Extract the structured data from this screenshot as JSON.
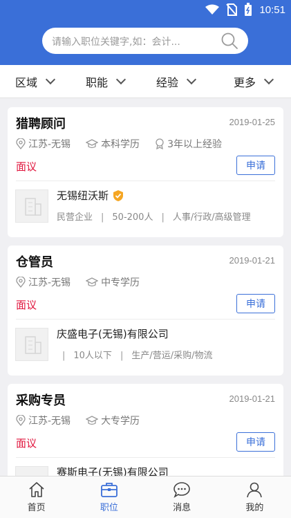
{
  "status": {
    "time": "10:51"
  },
  "search": {
    "placeholder": "请输入职位关键字,如：会计..."
  },
  "filters": [
    {
      "label": "区域"
    },
    {
      "label": "职能"
    },
    {
      "label": "经验"
    },
    {
      "label": "更多"
    }
  ],
  "jobs": [
    {
      "title": "猎聘顾问",
      "date": "2019-01-25",
      "location": "江苏-无锡",
      "education": "本科学历",
      "experience": "3年以上经验",
      "salary": "面议",
      "apply_label": "申请",
      "company": "无锡纽沃斯",
      "verified": true,
      "company_type": "民营企业",
      "company_size": "50-200人",
      "industry": "人事/行政/高级管理"
    },
    {
      "title": "仓管员",
      "date": "2019-01-21",
      "location": "江苏-无锡",
      "education": "中专学历",
      "salary": "面议",
      "apply_label": "申请",
      "company": "庆盛电子(无锡)有限公司",
      "company_size": "10人以下",
      "industry": "生产/营运/采购/物流"
    },
    {
      "title": "采购专员",
      "date": "2019-01-21",
      "location": "江苏-无锡",
      "education": "大专学历",
      "salary": "面议",
      "apply_label": "申请",
      "company": "赛斯电子(无锡)有限公司"
    }
  ],
  "tabs": [
    {
      "label": "首页",
      "icon": "home-icon"
    },
    {
      "label": "职位",
      "icon": "briefcase-icon",
      "active": true
    },
    {
      "label": "消息",
      "icon": "message-icon"
    },
    {
      "label": "我的",
      "icon": "user-icon"
    }
  ],
  "colors": {
    "primary": "#3a6fd8",
    "salary": "#e0143c",
    "verified": "#f5a623"
  }
}
